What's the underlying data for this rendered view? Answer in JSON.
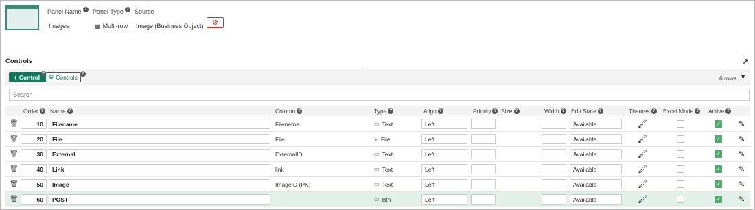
{
  "panel": {
    "name_label": "Panel Name",
    "name_value": "Images",
    "type_label": "Panel Type",
    "type_value": "Multi-row",
    "source_label": "Source",
    "source_value": "Image (Business Object)"
  },
  "section": {
    "title": "Controls"
  },
  "toolbar": {
    "add_control_label": "Control",
    "controls_label": "Controls",
    "rows_count": "6 rows"
  },
  "search": {
    "placeholder": "Search"
  },
  "columns": {
    "order": "Order",
    "name": "Name",
    "column": "Column",
    "type": "Type",
    "align": "Align",
    "priority": "Priority",
    "size": "Size",
    "width": "Width",
    "edit_state": "Edit State",
    "themes": "Themes",
    "excel_mode": "Excel Mode",
    "active": "Active"
  },
  "rows": [
    {
      "order": "10",
      "name": "Filename",
      "column": "Filename",
      "type": "Text",
      "type_icon": "textbox-icon",
      "align": "Left",
      "priority": "",
      "width": "",
      "edit_state": "Available",
      "excel_mode": false,
      "active": true
    },
    {
      "order": "20",
      "name": "File",
      "column": "File",
      "type": "File",
      "type_icon": "file-icon",
      "align": "Left",
      "priority": "",
      "width": "",
      "edit_state": "Available",
      "excel_mode": false,
      "active": true
    },
    {
      "order": "30",
      "name": "External",
      "column": "ExternalID",
      "type": "Text",
      "type_icon": "textbox-icon",
      "align": "Left",
      "priority": "",
      "width": "",
      "edit_state": "Available",
      "excel_mode": false,
      "active": true
    },
    {
      "order": "40",
      "name": "Link",
      "column": "link",
      "type": "Text",
      "type_icon": "textbox-icon",
      "align": "Left",
      "priority": "",
      "width": "",
      "edit_state": "Available",
      "excel_mode": false,
      "active": true
    },
    {
      "order": "50",
      "name": "Image",
      "column": "ImageID (PK)",
      "type": "Text",
      "type_icon": "textbox-icon",
      "align": "Left",
      "priority": "",
      "width": "",
      "edit_state": "Available",
      "excel_mode": false,
      "active": true
    },
    {
      "order": "60",
      "name": "POST",
      "column": "",
      "type": "Btn",
      "type_icon": "button-icon",
      "align": "Left",
      "priority": "",
      "width": "",
      "edit_state": "Available",
      "excel_mode": false,
      "active": true,
      "selected": true
    }
  ],
  "colors": {
    "primary": "#0e7a5a",
    "danger": "#c9302c",
    "check": "#4cae6a",
    "selected_row": "#e3efe9"
  }
}
